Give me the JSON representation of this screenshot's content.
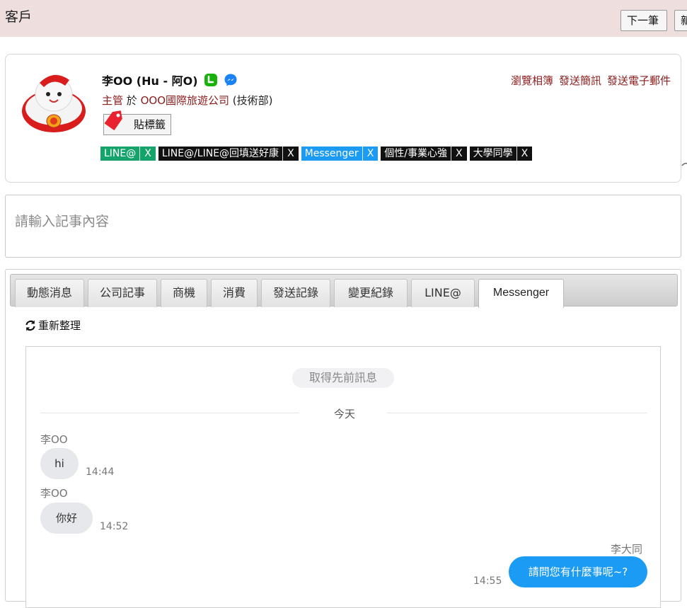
{
  "header": {
    "title": "客戶",
    "next_label": "下一筆",
    "new_label": "新增"
  },
  "profile": {
    "name": "李OO (Hu - 阿O)",
    "role": "主管",
    "at": "於",
    "company": "OOO國際旅遊公司",
    "department": "(技術部)",
    "tag_button": "貼標籤",
    "actions": [
      "瀏覽相簿",
      "發送簡訊",
      "發送電子郵件"
    ],
    "tags": [
      {
        "label": "LINE@",
        "x": "X",
        "color": "#14a36b"
      },
      {
        "label": "LINE@/LINE@回填送好康",
        "x": "X",
        "color": "#111111"
      },
      {
        "label": "Messenger",
        "x": "X",
        "color": "#1b9bf3"
      },
      {
        "label": "個性/事業心強",
        "x": "X",
        "color": "#111111"
      },
      {
        "label": "大學同學",
        "x": "X",
        "color": "#111111"
      }
    ]
  },
  "note": {
    "placeholder": "請輸入記事內容"
  },
  "tabs": [
    {
      "label": "動態消息"
    },
    {
      "label": "公司記事"
    },
    {
      "label": "商機"
    },
    {
      "label": "消費"
    },
    {
      "label": "發送記錄"
    },
    {
      "label": "變更紀錄"
    },
    {
      "label": "LINE@"
    },
    {
      "label": "Messenger"
    }
  ],
  "active_tab": "Messenger",
  "refresh_label": "重新整理",
  "chat": {
    "load_previous": "取得先前訊息",
    "day": "今天",
    "messages": [
      {
        "sender": "李OO",
        "text": "hi",
        "time": "14:44",
        "direction": "in"
      },
      {
        "sender": "李OO",
        "text": "你好",
        "time": "14:52",
        "direction": "in"
      },
      {
        "sender": "李大同",
        "text": "請問您有什麼事呢~?",
        "time": "14:55",
        "direction": "out"
      }
    ]
  },
  "colors": {
    "header_bg": "#efdede",
    "link": "#8b1d1d",
    "outgoing_bubble": "#1b9bf3",
    "incoming_bubble": "#e6e8ec"
  }
}
